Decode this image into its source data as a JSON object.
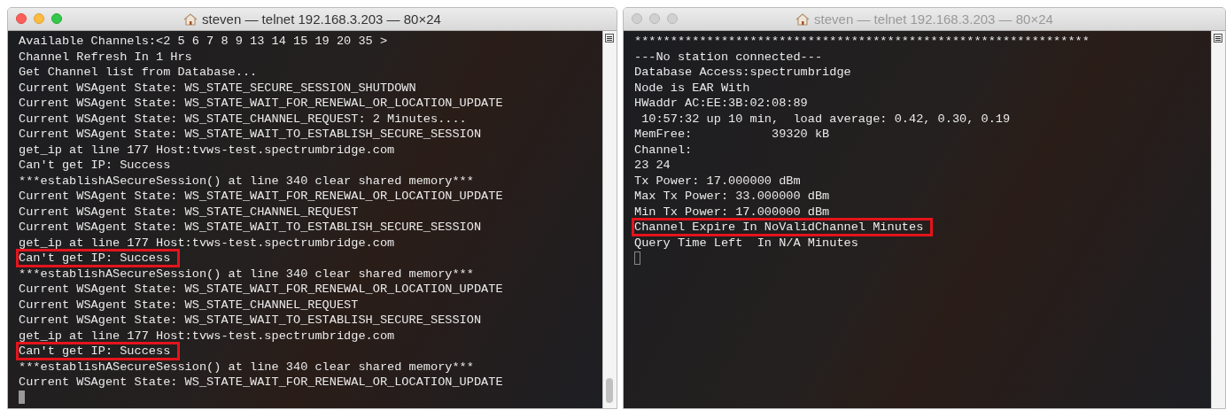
{
  "windows": [
    {
      "title": "steven — telnet 192.168.3.203 — 80×24",
      "active": true,
      "lines": [
        {
          "text": "Available Channels:<2 5 6 7 8 9 13 14 15 19 20 35 >",
          "highlighted": false
        },
        {
          "text": "Channel Refresh In 1 Hrs",
          "highlighted": false
        },
        {
          "text": "Get Channel list from Database...",
          "highlighted": false
        },
        {
          "text": "Current WSAgent State: WS_STATE_SECURE_SESSION_SHUTDOWN",
          "highlighted": false
        },
        {
          "text": "Current WSAgent State: WS_STATE_WAIT_FOR_RENEWAL_OR_LOCATION_UPDATE",
          "highlighted": false
        },
        {
          "text": "Current WSAgent State: WS_STATE_CHANNEL_REQUEST: 2 Minutes....",
          "highlighted": false
        },
        {
          "text": "Current WSAgent State: WS_STATE_WAIT_TO_ESTABLISH_SECURE_SESSION",
          "highlighted": false
        },
        {
          "text": "get_ip at line 177 Host:tvws-test.spectrumbridge.com",
          "highlighted": false
        },
        {
          "text": "Can't get IP: Success",
          "highlighted": false
        },
        {
          "text": "***establishASecureSession() at line 340 clear shared memory***",
          "highlighted": false
        },
        {
          "text": "Current WSAgent State: WS_STATE_WAIT_FOR_RENEWAL_OR_LOCATION_UPDATE",
          "highlighted": false
        },
        {
          "text": "Current WSAgent State: WS_STATE_CHANNEL_REQUEST",
          "highlighted": false
        },
        {
          "text": "Current WSAgent State: WS_STATE_WAIT_TO_ESTABLISH_SECURE_SESSION",
          "highlighted": false
        },
        {
          "text": "get_ip at line 177 Host:tvws-test.spectrumbridge.com",
          "highlighted": false
        },
        {
          "text": "Can't get IP: Success",
          "highlighted": true
        },
        {
          "text": "***establishASecureSession() at line 340 clear shared memory***",
          "highlighted": false
        },
        {
          "text": "Current WSAgent State: WS_STATE_WAIT_FOR_RENEWAL_OR_LOCATION_UPDATE",
          "highlighted": false
        },
        {
          "text": "Current WSAgent State: WS_STATE_CHANNEL_REQUEST",
          "highlighted": false
        },
        {
          "text": "Current WSAgent State: WS_STATE_WAIT_TO_ESTABLISH_SECURE_SESSION",
          "highlighted": false
        },
        {
          "text": "get_ip at line 177 Host:tvws-test.spectrumbridge.com",
          "highlighted": false
        },
        {
          "text": "Can't get IP: Success",
          "highlighted": true
        },
        {
          "text": "***establishASecureSession() at line 340 clear shared memory***",
          "highlighted": false
        },
        {
          "text": "Current WSAgent State: WS_STATE_WAIT_FOR_RENEWAL_OR_LOCATION_UPDATE",
          "highlighted": false
        }
      ]
    },
    {
      "title": "steven — telnet 192.168.3.203 — 80×24",
      "active": false,
      "lines": [
        {
          "text": "***************************************************************",
          "highlighted": false
        },
        {
          "text": "---No station connected---",
          "highlighted": false
        },
        {
          "text": "Database Access:spectrumbridge",
          "highlighted": false
        },
        {
          "text": "Node is EAR With",
          "highlighted": false
        },
        {
          "text": "HWaddr AC:EE:3B:02:08:89",
          "highlighted": false
        },
        {
          "text": " 10:57:32 up 10 min,  load average: 0.42, 0.30, 0.19",
          "highlighted": false
        },
        {
          "text": "MemFree:           39320 kB",
          "highlighted": false
        },
        {
          "text": "Channel:",
          "highlighted": false
        },
        {
          "text": "23 24",
          "highlighted": false
        },
        {
          "text": "Tx Power: 17.000000 dBm",
          "highlighted": false
        },
        {
          "text": "Max Tx Power: 33.000000 dBm",
          "highlighted": false
        },
        {
          "text": "Min Tx Power: 17.000000 dBm",
          "highlighted": false
        },
        {
          "text": "Channel Expire In NoValidChannel Minutes",
          "highlighted": true
        },
        {
          "text": "Query Time Left  In N/A Minutes",
          "highlighted": false
        }
      ]
    }
  ]
}
